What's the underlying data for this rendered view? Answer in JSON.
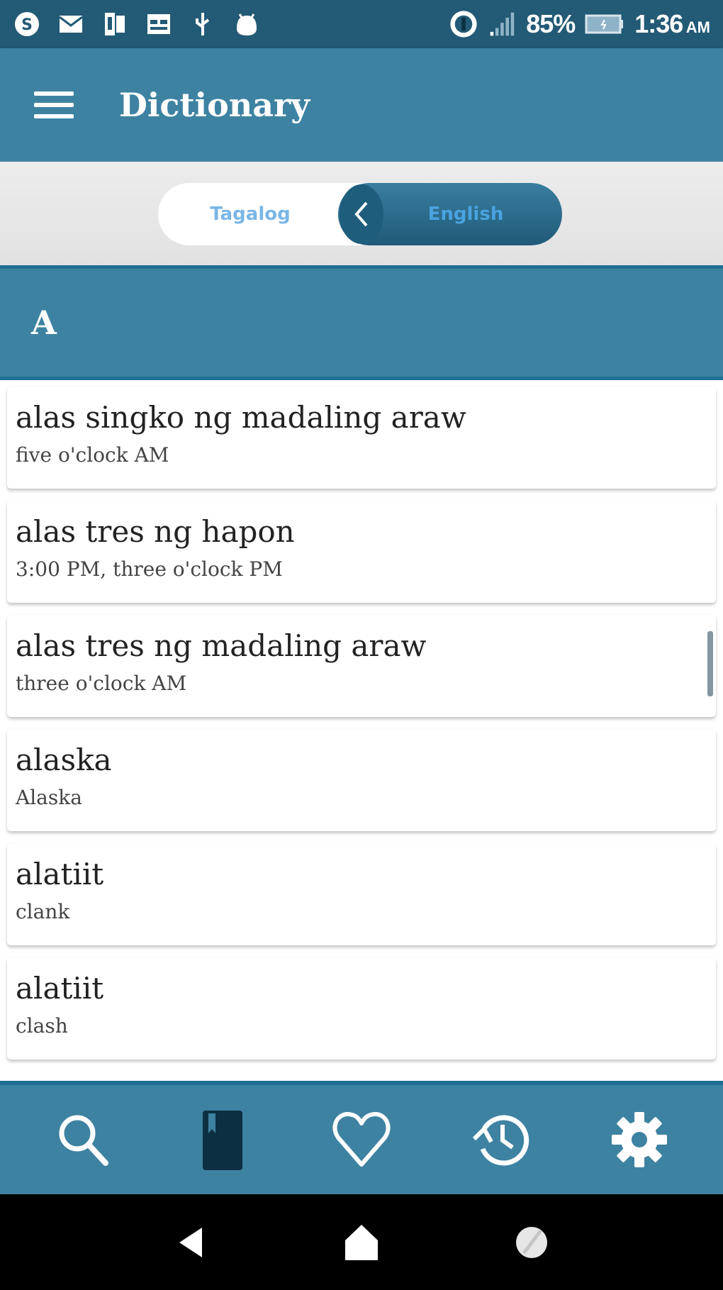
{
  "status_bar": {
    "left_icons": [
      "skype-icon",
      "mail-icon",
      "sim-card-icon",
      "calendar-icon",
      "usb-icon",
      "android-icon"
    ],
    "battery_percent": "85%",
    "time": "1:36",
    "ampm": "AM"
  },
  "app_bar": {
    "title": "Dictionary",
    "menu_icon": "menu-icon"
  },
  "language_toggle": {
    "source_language": "Tagalog",
    "target_language": "English",
    "swap_icon": "chevron-left-icon"
  },
  "section": {
    "letter": "A"
  },
  "entries": [
    {
      "term": "alas singko ng madaling araw",
      "definition": "five o'clock AM"
    },
    {
      "term": "alas tres ng hapon",
      "definition": "3:00 PM, three o'clock PM"
    },
    {
      "term": "alas tres ng madaling araw",
      "definition": "three o'clock AM"
    },
    {
      "term": "alaska",
      "definition": "Alaska"
    },
    {
      "term": "alatiit",
      "definition": "clank"
    },
    {
      "term": "alatiit",
      "definition": "clash"
    }
  ],
  "bottom_nav": {
    "items": [
      {
        "name": "search",
        "icon": "search-icon",
        "active": false
      },
      {
        "name": "dictionary",
        "icon": "book-icon",
        "active": true
      },
      {
        "name": "favorites",
        "icon": "heart-icon",
        "active": false
      },
      {
        "name": "history",
        "icon": "history-icon",
        "active": false
      },
      {
        "name": "settings",
        "icon": "gear-icon",
        "active": false
      }
    ]
  },
  "colors": {
    "status_bar": "#235a75",
    "primary": "#3e82a2",
    "primary_dark": "#1e6f93",
    "toggle_text": "#7ab6e6",
    "active_nav_icon": "#0d2f42"
  }
}
